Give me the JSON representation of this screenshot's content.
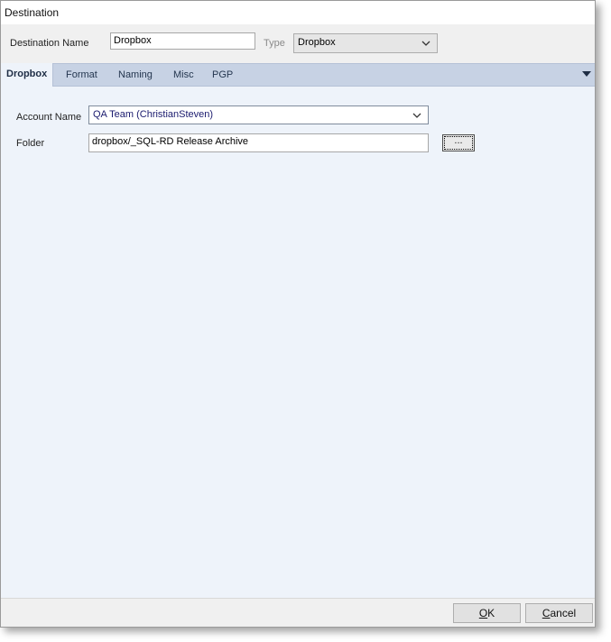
{
  "window": {
    "title": "Destination"
  },
  "header": {
    "destination_name_label": "Destination Name",
    "destination_name_value": "Dropbox",
    "type_label": "Type",
    "type_value": "Dropbox"
  },
  "tabs": [
    {
      "label": "Dropbox",
      "active": true
    },
    {
      "label": "Format"
    },
    {
      "label": "Naming"
    },
    {
      "label": "Misc"
    },
    {
      "label": "PGP"
    }
  ],
  "dropbox_tab": {
    "account_label": "Account Name",
    "account_value": "QA Team (ChristianSteven)",
    "folder_label": "Folder",
    "folder_value": "dropbox/_SQL-RD Release Archive",
    "browse_label": "..."
  },
  "footer": {
    "ok_prefix": "",
    "ok_hotkey": "O",
    "ok_rest": "K",
    "cancel_hotkey": "C",
    "cancel_rest": "ancel"
  },
  "icons": {
    "dropdown": "chevron-down-icon",
    "tab_menu": "triangle-down-icon"
  }
}
